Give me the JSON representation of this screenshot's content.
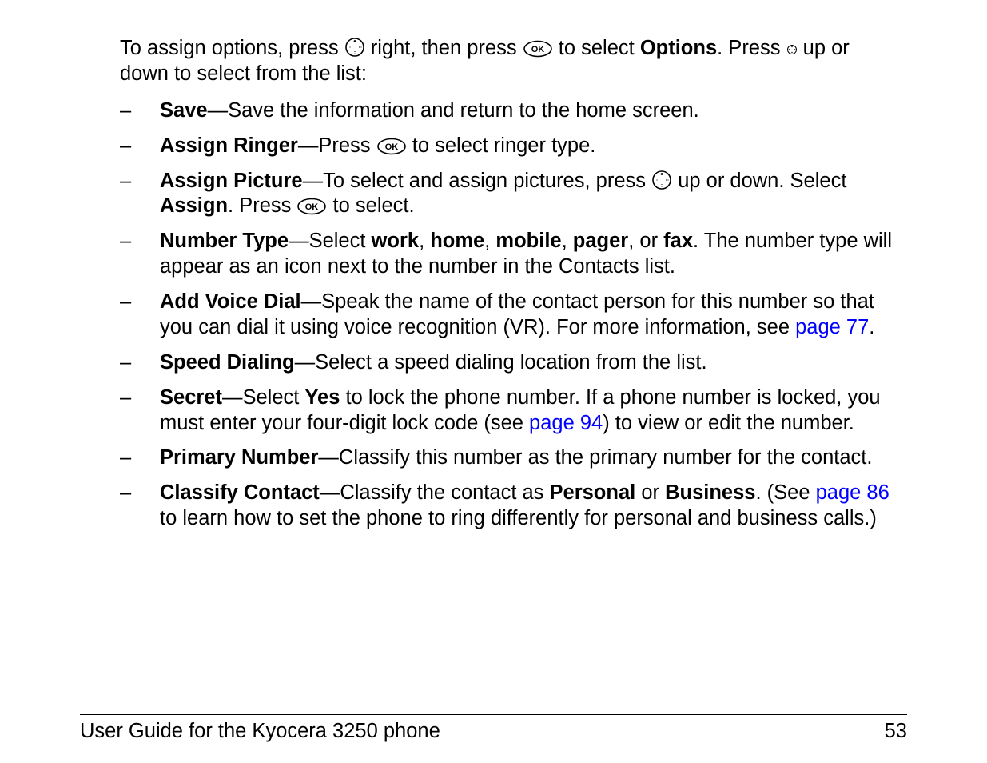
{
  "intro": {
    "t1": "To assign options, press ",
    "t2": " right, then press ",
    "t3": " to select ",
    "options": "Options",
    "t4": ". Press ",
    "t5": " up or down to select from the list:"
  },
  "items": {
    "save": {
      "label": "Save",
      "text": "—Save the information and return to the home screen."
    },
    "ringer": {
      "label": "Assign Ringer",
      "t1": "—Press ",
      "t2": " to select ringer type."
    },
    "picture": {
      "label": "Assign Picture",
      "t1": "—To select and assign pictures, press ",
      "t2": " up or down. Select ",
      "assign": "Assign",
      "t3": ". Press ",
      "t4": " to select."
    },
    "numtype": {
      "label": "Number Type",
      "t1": "—Select ",
      "w": "work",
      "c1": ", ",
      "h": "home",
      "c2": ", ",
      "m": "mobile",
      "c3": ", ",
      "p": "pager",
      "c4": ", or ",
      "f": "fax",
      "t2": ". The number type will appear as an icon next to the number in the Contacts list."
    },
    "voice": {
      "label": "Add Voice Dial",
      "t1": "—Speak the name of the contact person for this number so that you can dial it using voice recognition (VR). For more information, see ",
      "link": "page 77",
      "t2": "."
    },
    "speed": {
      "label": "Speed Dialing",
      "text": "—Select a speed dialing location from the list."
    },
    "secret": {
      "label": "Secret",
      "t1": "—Select ",
      "yes": "Yes",
      "t2": " to lock the phone number. If a phone number is locked, you must enter your four-digit lock code (see ",
      "link": "page 94",
      "t3": ") to view or edit the number."
    },
    "primary": {
      "label": "Primary Number",
      "text": "—Classify this number as the primary number for the contact."
    },
    "classify": {
      "label": "Classify Contact",
      "t1": "—Classify the contact as ",
      "pers": "Personal",
      "t2": " or ",
      "bus": "Business",
      "t3": ". (See ",
      "link": "page 86",
      "t4": " to learn how to set the phone to ring differently for personal and business calls.)"
    }
  },
  "footer": {
    "title": "User Guide for the Kyocera 3250 phone",
    "page": "53"
  }
}
